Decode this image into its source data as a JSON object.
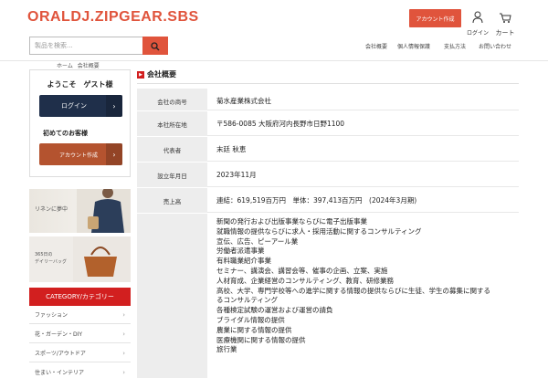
{
  "header": {
    "logo": "ORALDJ.ZIPGEAR.SBS",
    "account_create_label": "アカウント作成",
    "login_label": "ログイン",
    "cart_label": "カート",
    "search": {
      "placeholder": "製品を検索..."
    },
    "nav": [
      "会社概要",
      "個人情報保護",
      "支払方法",
      "お問い合わせ"
    ]
  },
  "breadcrumb": {
    "home": "ホーム",
    "current": "会社概要"
  },
  "sidebar": {
    "welcome_title": "ようこそ　ゲスト様",
    "login_button": "ログイン",
    "first_time": "初めてのお客様",
    "account_button": "アカウント作成",
    "banner1_text": "リネンに夢中",
    "banner2_lines": [
      "365日の",
      "デイリーバッグ"
    ],
    "category_title": "CATEGORY/カテゴリー",
    "categories": [
      "ファッション",
      "花・ガーデン・DIY",
      "スポーツ/アウトドア",
      "住まい・インテリア"
    ]
  },
  "main": {
    "section_title": "会社概要",
    "rows": [
      {
        "label": "会社の商号",
        "value": "菊水産業株式会社"
      },
      {
        "label": "本社所在地",
        "value": "〒586-0085 大阪府河内長野市日野1100"
      },
      {
        "label": "代表者",
        "value": "末廷 秋恵"
      },
      {
        "label": "設立年月日",
        "value": "2023年11月"
      },
      {
        "label": "売上高",
        "value": "連結：619,519百万円　単体：397,413百万円　(2024年3月期)"
      }
    ],
    "business": [
      "新聞の発行および出版事業ならびに電子出版事業",
      "就職情報の提供ならびに求人・採用活動に関するコンサルティング",
      "宣伝、広告、ピーアール業",
      "労働者派遣事業",
      "有料職業紹介事業",
      "セミナー、講演会、講習会等、催事の企画、立案、実施",
      "人材育成、企業経営のコンサルティング、教育、研修業務",
      "高校、大学、専門学校等への進学に関する情報の提供ならびに生徒、学生の募集に関する",
      "るコンサルティング",
      "各種検定試験の運営および運営の請負",
      "ブライダル情報の提供",
      "農業に関する情報の提供",
      "医療機関に関する情報の提供",
      "旅行業"
    ]
  },
  "colors": {
    "accent": "#e0543c",
    "navy": "#1f2f4a",
    "brown": "#b4532f",
    "category_red": "#d21f1f"
  }
}
